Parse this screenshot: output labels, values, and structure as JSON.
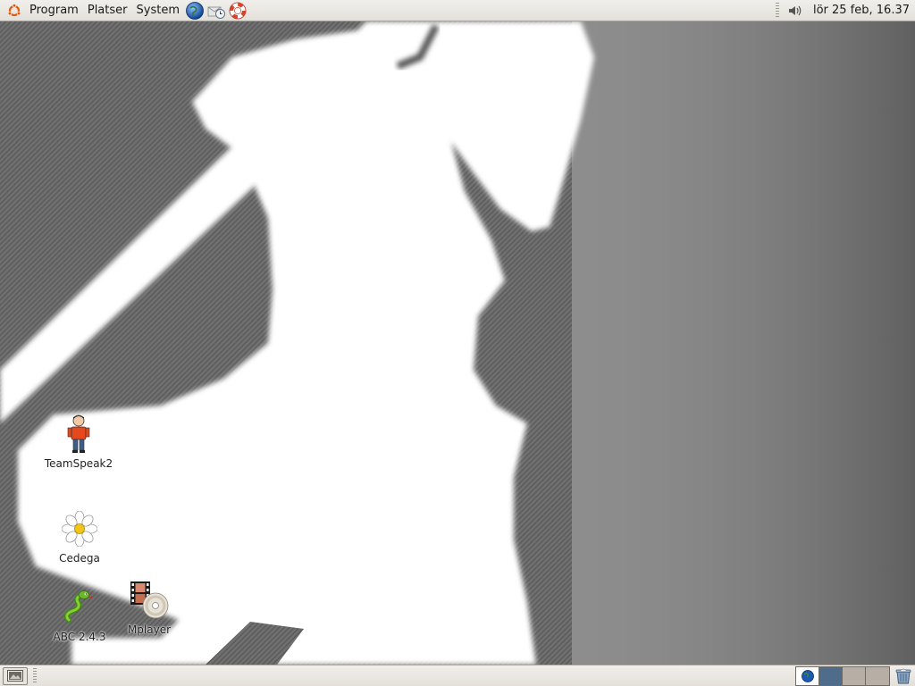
{
  "top_panel": {
    "menus": [
      {
        "label": "Program"
      },
      {
        "label": "Platser"
      },
      {
        "label": "System"
      }
    ],
    "launchers": [
      "web-browser-icon",
      "email-client-icon",
      "help-icon"
    ],
    "tray_icons": [
      "volume-icon"
    ],
    "clock": "lör 25 feb, 16.37"
  },
  "desktop": {
    "icons": [
      {
        "label": "TeamSpeak2",
        "icon": "teamspeak-icon"
      },
      {
        "label": "Cedega",
        "icon": "cedega-flower-icon"
      },
      {
        "label": "ABC 2.4.3",
        "icon": "python-snake-icon"
      },
      {
        "label": "Mplayer",
        "icon": "mplayer-film-disc-icon"
      }
    ]
  },
  "bottom_panel": {
    "show_desktop_icon": "show-desktop-icon",
    "workspaces": 4,
    "active_workspace": 2,
    "trash_icon": "trash-icon"
  },
  "colors": {
    "panel_bg": "#e8e5df",
    "wallpaper_dark": "#5c5c5c",
    "wallpaper_mid": "#8c8c8c",
    "silhouette": "#ffffff",
    "workspace_active": "#4f6c8a"
  }
}
